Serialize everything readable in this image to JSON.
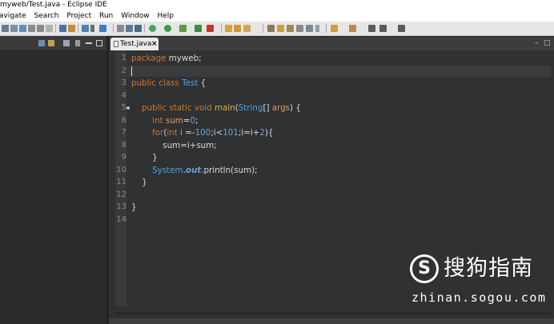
{
  "window": {
    "title": "myweb/Test.java - Eclipse IDE"
  },
  "menu": [
    "avigate",
    "Search",
    "Project",
    "Run",
    "Window",
    "Help"
  ],
  "editor": {
    "tab_label": "Test.java",
    "close_glyph": "×",
    "minimize_glyph": "–",
    "maximize_glyph": "□",
    "lines": [
      {
        "n": "1",
        "tokens": [
          {
            "t": "package ",
            "c": "pk"
          },
          {
            "t": "myweb;",
            "c": "plain"
          }
        ]
      },
      {
        "n": "2",
        "tokens": []
      },
      {
        "n": "3",
        "tokens": [
          {
            "t": "public class ",
            "c": "kw"
          },
          {
            "t": "Test",
            "c": "cls"
          },
          {
            "t": " {",
            "c": "plain"
          }
        ]
      },
      {
        "n": "4",
        "tokens": []
      },
      {
        "n": "5",
        "tokens": [
          {
            "t": "    public static void ",
            "c": "kw"
          },
          {
            "t": "main",
            "c": "mth"
          },
          {
            "t": "(",
            "c": "plain"
          },
          {
            "t": "String",
            "c": "cls"
          },
          {
            "t": "[] ",
            "c": "plain"
          },
          {
            "t": "args",
            "c": "var"
          },
          {
            "t": ") {",
            "c": "plain"
          }
        ]
      },
      {
        "n": "6",
        "tokens": [
          {
            "t": "        int ",
            "c": "kw"
          },
          {
            "t": "sum",
            "c": "var"
          },
          {
            "t": "=",
            "c": "plain"
          },
          {
            "t": "0",
            "c": "num"
          },
          {
            "t": ";",
            "c": "plain"
          }
        ]
      },
      {
        "n": "7",
        "tokens": [
          {
            "t": "        for",
            "c": "kw"
          },
          {
            "t": "(",
            "c": "plain"
          },
          {
            "t": "int ",
            "c": "kw"
          },
          {
            "t": "i",
            "c": "var"
          },
          {
            "t": " =-",
            "c": "plain"
          },
          {
            "t": "100",
            "c": "num"
          },
          {
            "t": ";i<",
            "c": "plain"
          },
          {
            "t": "101",
            "c": "num"
          },
          {
            "t": ";i=i+",
            "c": "plain"
          },
          {
            "t": "2",
            "c": "num"
          },
          {
            "t": "){",
            "c": "plain"
          }
        ]
      },
      {
        "n": "8",
        "tokens": [
          {
            "t": "            sum=i+sum;",
            "c": "plain"
          }
        ]
      },
      {
        "n": "9",
        "tokens": [
          {
            "t": "        }",
            "c": "plain"
          }
        ]
      },
      {
        "n": "10",
        "tokens": [
          {
            "t": "        System",
            "c": "cls"
          },
          {
            "t": ".",
            "c": "plain"
          },
          {
            "t": "out",
            "c": "fld"
          },
          {
            "t": ".println(sum);",
            "c": "plain"
          }
        ]
      },
      {
        "n": "11",
        "tokens": [
          {
            "t": "    }",
            "c": "plain"
          }
        ]
      },
      {
        "n": "12",
        "tokens": []
      },
      {
        "n": "13",
        "tokens": [
          {
            "t": "}",
            "c": "plain"
          }
        ]
      },
      {
        "n": "14",
        "tokens": []
      }
    ]
  },
  "watermark": {
    "logo_letter": "S",
    "text": "搜狗指南",
    "url": "zhinan.sogou.com"
  },
  "icons": [
    "file-java-icon",
    "close-icon",
    "minimize-icon",
    "maximize-icon",
    "fold-marker-icon"
  ]
}
